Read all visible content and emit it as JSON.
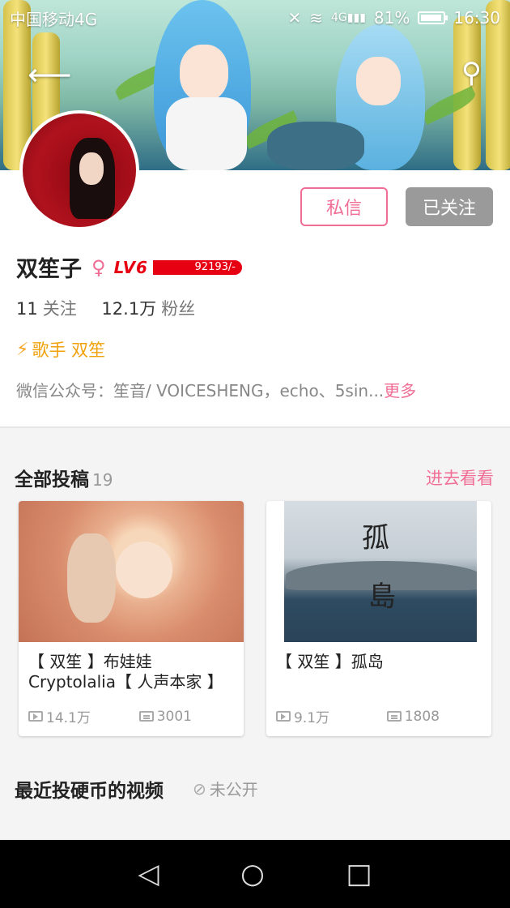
{
  "statusbar": {
    "carrier": "中国移动4G",
    "network": "4G",
    "battery": "81%",
    "battery_level": 0.81,
    "time": "16:30"
  },
  "header": {
    "back_icon": "back-arrow-icon",
    "search_icon": "search-icon"
  },
  "profile": {
    "message_label": "私信",
    "followed_label": "已关注",
    "name": "双笙子",
    "gender_icon": "female-icon",
    "level": "LV6",
    "exp": "92193/-",
    "following_count": "11",
    "following_label": "关注",
    "fans_count": "12.1万",
    "fans_label": "粉丝",
    "verify_icon": "lightning-icon",
    "verify_text": "歌手 双笙",
    "description": "微信公众号：笙音/ VOICESHENG，echo、5sin...",
    "more_label": "更多"
  },
  "submissions": {
    "title": "全部投稿",
    "count": "19",
    "enter_label": "进去看看",
    "items": [
      {
        "title": "【 双笙 】布娃娃 Cryptolalia【 人声本家 】",
        "plays": "14.1万",
        "danmaku": "3001"
      },
      {
        "title": "【 双笙 】孤岛",
        "plays": "9.1万",
        "danmaku": "1808",
        "cover_text_1": "孤",
        "cover_text_2": "島"
      }
    ]
  },
  "coins": {
    "title": "最近投硬币的视频",
    "private_label": "未公开"
  },
  "colors": {
    "accent": "#f06e96",
    "level_red": "#e60012",
    "verify_orange": "#f0a10b"
  }
}
